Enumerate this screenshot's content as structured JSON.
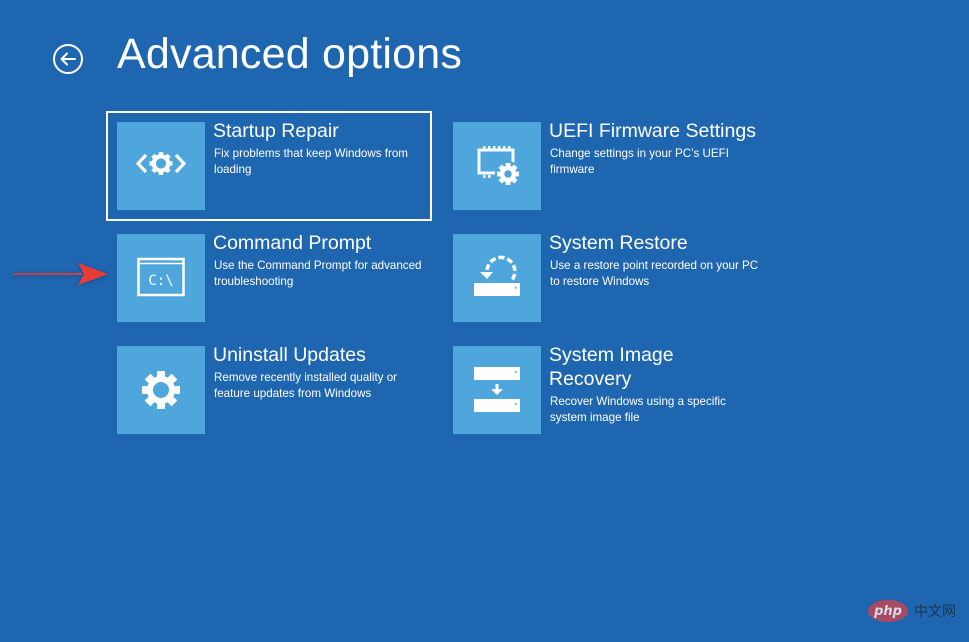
{
  "page": {
    "title": "Advanced options",
    "back_icon": "back-arrow-circle-icon",
    "colors": {
      "background": "#1f66b1",
      "tile": "#4ea6dd",
      "text": "#ffffff",
      "annotation_arrow": "#e83a34"
    }
  },
  "options": [
    {
      "id": "startup-repair",
      "title": "Startup Repair",
      "description": "Fix problems that keep Windows from loading",
      "icon": "code-gear-icon",
      "selected": true
    },
    {
      "id": "uefi-firmware-settings",
      "title": "UEFI Firmware Settings",
      "description": "Change settings in your PC’s UEFI firmware",
      "icon": "chip-gear-icon",
      "selected": false
    },
    {
      "id": "command-prompt",
      "title": "Command Prompt",
      "description": "Use the Command Prompt for advanced troubleshooting",
      "icon": "command-prompt-icon",
      "icon_text": "C:\\",
      "selected": false
    },
    {
      "id": "system-restore",
      "title": "System Restore",
      "description": "Use a restore point recorded on your PC to restore Windows",
      "icon": "restore-drive-icon",
      "selected": false
    },
    {
      "id": "uninstall-updates",
      "title": "Uninstall Updates",
      "description": "Remove recently installed quality or feature updates from Windows",
      "icon": "gear-icon",
      "selected": false
    },
    {
      "id": "system-image-recovery",
      "title": "System Image Recovery",
      "description": "Recover Windows using a specific system image file",
      "icon": "drive-to-drive-icon",
      "selected": false
    }
  ],
  "annotation": {
    "type": "pointer-arrow",
    "target": "command-prompt"
  },
  "watermark": {
    "logo_text": "php",
    "site_text": "中文网"
  }
}
